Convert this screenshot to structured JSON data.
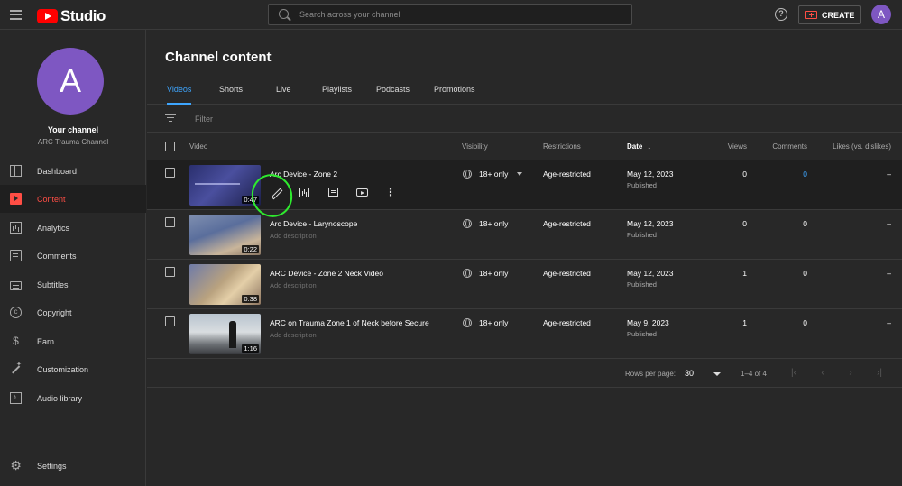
{
  "header": {
    "logo_text": "Studio",
    "search_placeholder": "Search across your channel",
    "help_glyph": "?",
    "create_label": "CREATE",
    "avatar_letter": "A"
  },
  "sidebar": {
    "avatar_letter": "A",
    "channel_title": "Your channel",
    "channel_name": "ARC Trauma Channel",
    "items": [
      {
        "label": "Dashboard",
        "icon": "dashboard-icon"
      },
      {
        "label": "Content",
        "icon": "content-icon",
        "active": true
      },
      {
        "label": "Analytics",
        "icon": "analytics-icon"
      },
      {
        "label": "Comments",
        "icon": "comments-icon"
      },
      {
        "label": "Subtitles",
        "icon": "subtitles-icon"
      },
      {
        "label": "Copyright",
        "icon": "copyright-icon"
      },
      {
        "label": "Earn",
        "icon": "earn-icon"
      },
      {
        "label": "Customization",
        "icon": "customization-icon"
      },
      {
        "label": "Audio library",
        "icon": "audio-library-icon"
      }
    ],
    "settings_label": "Settings"
  },
  "main": {
    "title": "Channel content",
    "tabs": [
      {
        "label": "Videos",
        "active": true
      },
      {
        "label": "Shorts"
      },
      {
        "label": "Live"
      },
      {
        "label": "Playlists"
      },
      {
        "label": "Podcasts"
      },
      {
        "label": "Promotions"
      }
    ],
    "filter_placeholder": "Filter",
    "columns": {
      "video": "Video",
      "visibility": "Visibility",
      "restrictions": "Restrictions",
      "date": "Date",
      "views": "Views",
      "comments": "Comments",
      "likes": "Likes (vs. dislikes)"
    },
    "rows": [
      {
        "title": "Arc Device - Zone 2",
        "description": "",
        "duration": "0:47",
        "visibility": "18+ only",
        "restrictions": "Age-restricted",
        "date": "May 12, 2023",
        "status": "Published",
        "views": "0",
        "comments": "0",
        "likes": "–"
      },
      {
        "title": "Arc Device - Larynoscope",
        "description": "Add description",
        "duration": "0:22",
        "visibility": "18+ only",
        "restrictions": "Age-restricted",
        "date": "May 12, 2023",
        "status": "Published",
        "views": "0",
        "comments": "0",
        "likes": "–"
      },
      {
        "title": "ARC Device - Zone 2 Neck Video",
        "description": "Add description",
        "duration": "0:38",
        "visibility": "18+ only",
        "restrictions": "Age-restricted",
        "date": "May 12, 2023",
        "status": "Published",
        "views": "1",
        "comments": "0",
        "likes": "–"
      },
      {
        "title": "ARC on Trauma Zone 1 of Neck before Secure",
        "description": "Add description",
        "duration": "1:16",
        "visibility": "18+ only",
        "restrictions": "Age-restricted",
        "date": "May 9, 2023",
        "status": "Published",
        "views": "1",
        "comments": "0",
        "likes": "–"
      }
    ],
    "pager": {
      "rows_label": "Rows per page:",
      "rows_value": "30",
      "range": "1–4 of 4"
    }
  },
  "colors": {
    "accent_blue": "#3ea6ff",
    "accent_red": "#ff4e45",
    "highlight_green": "#2eea2e"
  }
}
